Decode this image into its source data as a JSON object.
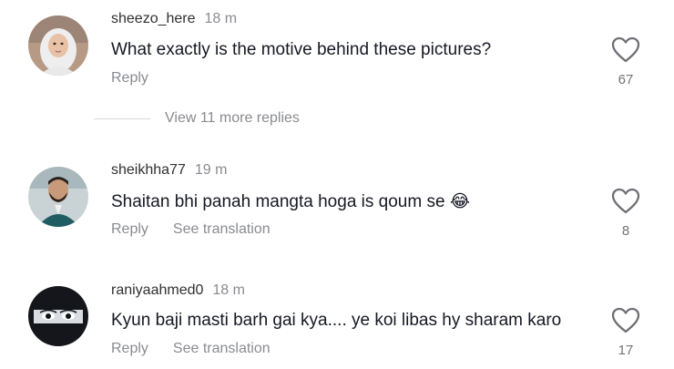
{
  "comments": [
    {
      "username": "sheezo_here",
      "time": "18 m",
      "text": "What exactly is the motive behind these pictures?",
      "reply_label": "Reply",
      "likes": "67",
      "avatar_icon": "avatar-hijab-woman"
    },
    {
      "username": "sheikhha77",
      "time": "19 m",
      "text": "Shaitan bhi panah mangta hoga is qoum se 😂",
      "reply_label": "Reply",
      "translate_label": "See translation",
      "likes": "8",
      "avatar_icon": "avatar-bearded-man"
    },
    {
      "username": "raniyaahmed0",
      "time": "18 m",
      "text": "Kyun baji masti barh gai kya.... ye koi libas hy sharam karo",
      "reply_label": "Reply",
      "translate_label": "See translation",
      "likes": "17",
      "avatar_icon": "avatar-veiled-eyes"
    }
  ],
  "view_more_replies": "View 11 more replies",
  "like_icon": "heart-outline-icon"
}
